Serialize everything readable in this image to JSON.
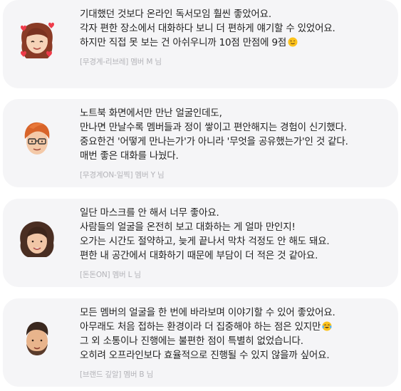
{
  "reviews": [
    {
      "avatar_icon": "woman-memoji-with-hearts-icon",
      "lines": [
        "기대했던 것보다 온라인 독서모임 훨씬 좋았어요.",
        "각자 편한 장소에서 대화하다 보니 더 편하게 얘기할 수 있었어요.",
        "하지만 직접 못 보는 건 아쉬우니까 10점 만점에 9점"
      ],
      "emoji_icon": "winking-face-icon",
      "author": "[무경계-리브레] 멤버 M 님"
    },
    {
      "avatar_icon": "man-memoji-with-glasses-icon",
      "lines": [
        "노트북 화면에서만 만난 얼굴인데도,",
        "만나면 만날수록 멤버들과 정이 쌓이고 편안해지는 경험이 신기했다.",
        "중요한건 '어떻게 만나는가'가 아니라 '무엇을 공유했는가'인 것 같다.",
        "매번 좋은 대화를 나눴다."
      ],
      "author": "[무경계ON-일찍] 멤버 Y 님"
    },
    {
      "avatar_icon": "woman-memoji-curly-hair-icon",
      "lines": [
        "일단 마스크를 안 해서 너무 좋아요.",
        "사람들의 얼굴을 온전히 보고 대화하는 게 얼마 만인지!",
        "오가는 시간도 절약하고, 늦게 끝나서 막차 걱정도 안 해도 돼요.",
        "편한 내 공간에서 대화하기 때문에 부담이 더 적은 것 같아요."
      ],
      "author": "[돈돈ON] 멤버 L 님"
    },
    {
      "avatar_icon": "man-memoji-beard-icon",
      "lines": [
        "모든 멤버의 얼굴을 한 번에 바라보며 이야기할 수 있어 좋았어요.",
        "아무래도 처음 접하는 환경이라 더 집중해야 하는 점은 있지만",
        "그 외 소통이나 진행에는 불편한 점이 특별히 없었습니다.",
        "오히려 오프라인보다 효율적으로 진행될 수 있지 않을까 싶어요."
      ],
      "emoji_icon": "tears-of-joy-face-icon",
      "author": "[브랜드 깊알] 멤버 B 님"
    }
  ]
}
